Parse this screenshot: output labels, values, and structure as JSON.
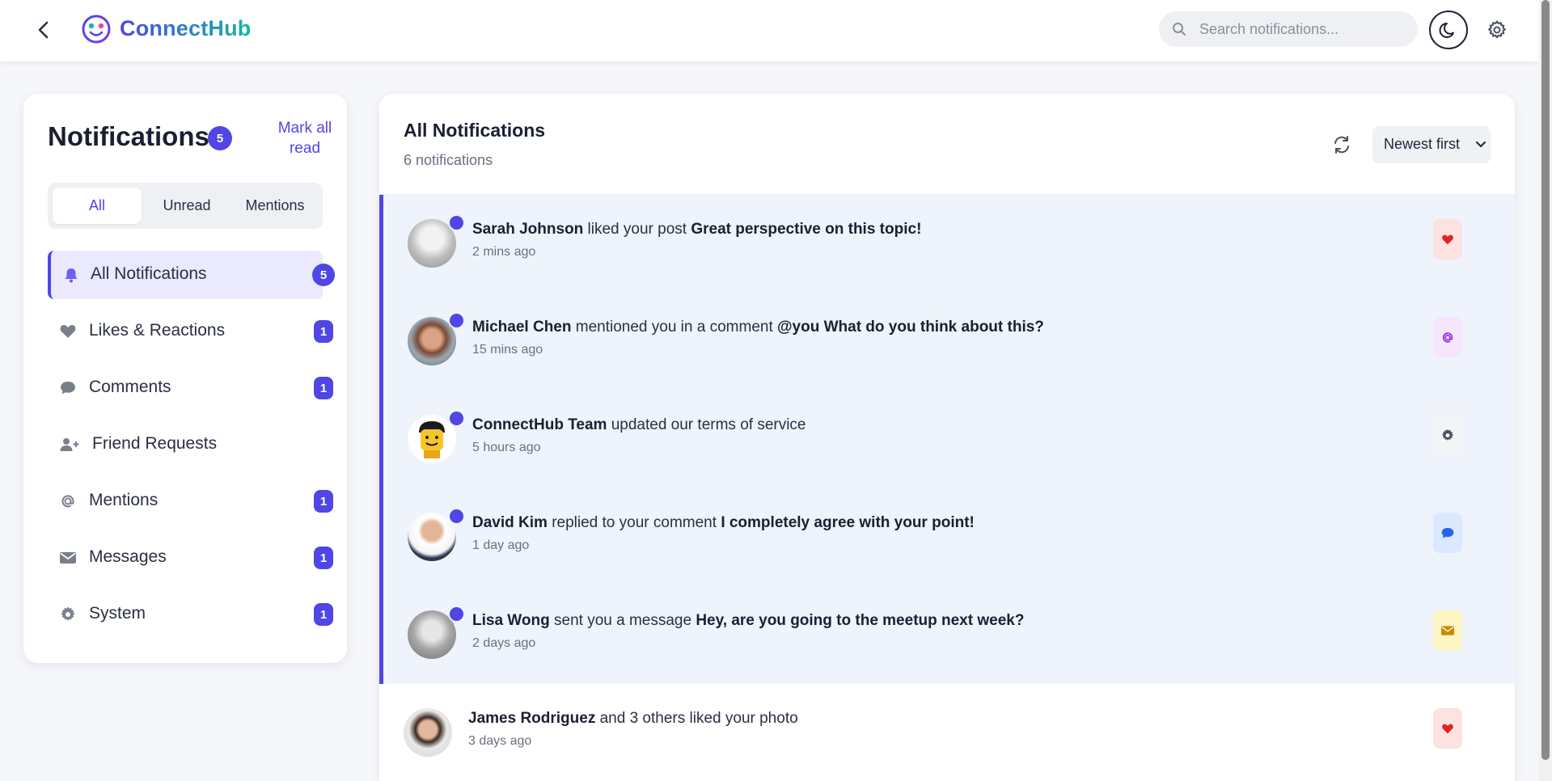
{
  "header": {
    "app_name": "ConnectHub",
    "search_placeholder": "Search notifications..."
  },
  "sidebar": {
    "title": "Notifications",
    "unread_count": "5",
    "mark_all_label_line1": "Mark all",
    "mark_all_label_line2": "read",
    "filter_tabs": [
      {
        "label": "All",
        "active": true
      },
      {
        "label": "Unread",
        "active": false
      },
      {
        "label": "Mentions",
        "active": false
      }
    ],
    "items": [
      {
        "label": "All Notifications",
        "icon": "bell-icon",
        "count": "5",
        "active": true
      },
      {
        "label": "Likes & Reactions",
        "icon": "heart-icon",
        "count": "1"
      },
      {
        "label": "Comments",
        "icon": "comment-icon",
        "count": "1"
      },
      {
        "label": "Friend Requests",
        "icon": "user-plus-icon",
        "count": ""
      },
      {
        "label": "Mentions",
        "icon": "at-icon",
        "count": "1"
      },
      {
        "label": "Messages",
        "icon": "envelope-icon",
        "count": "1"
      },
      {
        "label": "System",
        "icon": "gear-icon",
        "count": "1"
      }
    ]
  },
  "main": {
    "title": "All Notifications",
    "subtitle": "6 notifications",
    "sort_label": "Newest first",
    "notifications": [
      {
        "user": "Sarah Johnson",
        "action": "liked your post",
        "detail": "Great perspective on this topic!",
        "time": "2 mins ago",
        "unread": true,
        "type_icon": "heart-icon",
        "type_color": "#e02424",
        "type_bg": "#fde2e2"
      },
      {
        "user": "Michael Chen",
        "action": "mentioned you in a comment",
        "detail": "@you What do you think about this?",
        "time": "15 mins ago",
        "unread": true,
        "type_icon": "at-icon",
        "type_color": "#9333ea",
        "type_bg": "#f5e6fd"
      },
      {
        "user": "ConnectHub Team",
        "action": "updated our terms of service",
        "detail": "",
        "time": "5 hours ago",
        "unread": true,
        "type_icon": "gear-icon",
        "type_color": "#4b5160",
        "type_bg": "#f3f4f6"
      },
      {
        "user": "David Kim",
        "action": "replied to your comment",
        "detail": "I completely agree with your point!",
        "time": "1 day ago",
        "unread": true,
        "type_icon": "comment-icon",
        "type_color": "#2563eb",
        "type_bg": "#dbe8fe"
      },
      {
        "user": "Lisa Wong",
        "action": "sent you a message",
        "detail": "Hey, are you going to the meetup next week?",
        "time": "2 days ago",
        "unread": true,
        "type_icon": "envelope-icon",
        "type_color": "#ca8a04",
        "type_bg": "#fdf6c5"
      },
      {
        "user": "James Rodriguez",
        "action": "and 3 others liked your photo",
        "detail": "",
        "time": "3 days ago",
        "unread": false,
        "type_icon": "heart-icon",
        "type_color": "#e02424",
        "type_bg": "#fde2e2"
      }
    ]
  }
}
